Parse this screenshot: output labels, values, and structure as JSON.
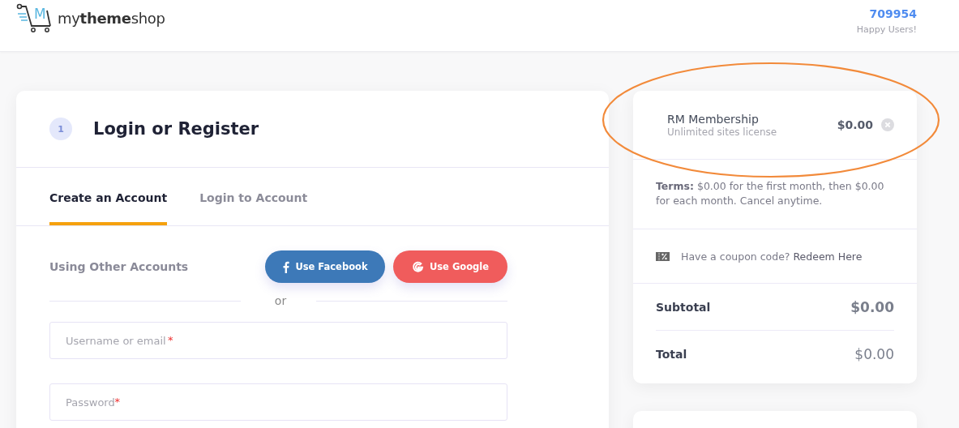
{
  "header": {
    "logo_mark": "M",
    "logo_text": "my**theme**shop",
    "stat_value": "709954",
    "stat_label": "Happy Users!"
  },
  "login": {
    "step": "1",
    "title": "Login or Register",
    "tabs": [
      {
        "label": "Create an Account",
        "selected": true
      },
      {
        "label": "Login to Account",
        "selected": false
      }
    ],
    "other_accounts_label": "Using Other Accounts",
    "social_buttons": [
      {
        "kind": "facebook",
        "label": "Use Facebook"
      },
      {
        "kind": "google",
        "label": "Use Google"
      }
    ],
    "divider_text": "or",
    "fields": [
      {
        "placeholder": "Username or email",
        "required_mark": "*"
      },
      {
        "placeholder": "Password",
        "required_mark": "*"
      }
    ]
  },
  "cart": {
    "item": {
      "name": "RM Membership",
      "description": "Unlimited sites license",
      "price": "$0.00"
    },
    "terms": "**Terms:** $0.00 for the first month, then $0.00 for each month. Cancel anytime.",
    "coupon_text": "Have a coupon code?",
    "coupon_link": "Redeem Here",
    "totals": [
      {
        "label": "Subtotal",
        "value": "$0.00",
        "kind": "subtotal"
      },
      {
        "label": "Total",
        "value": "$0.00",
        "kind": "total"
      }
    ]
  },
  "annotation": {
    "kind": "ellipse",
    "color": "#f28a3a"
  }
}
